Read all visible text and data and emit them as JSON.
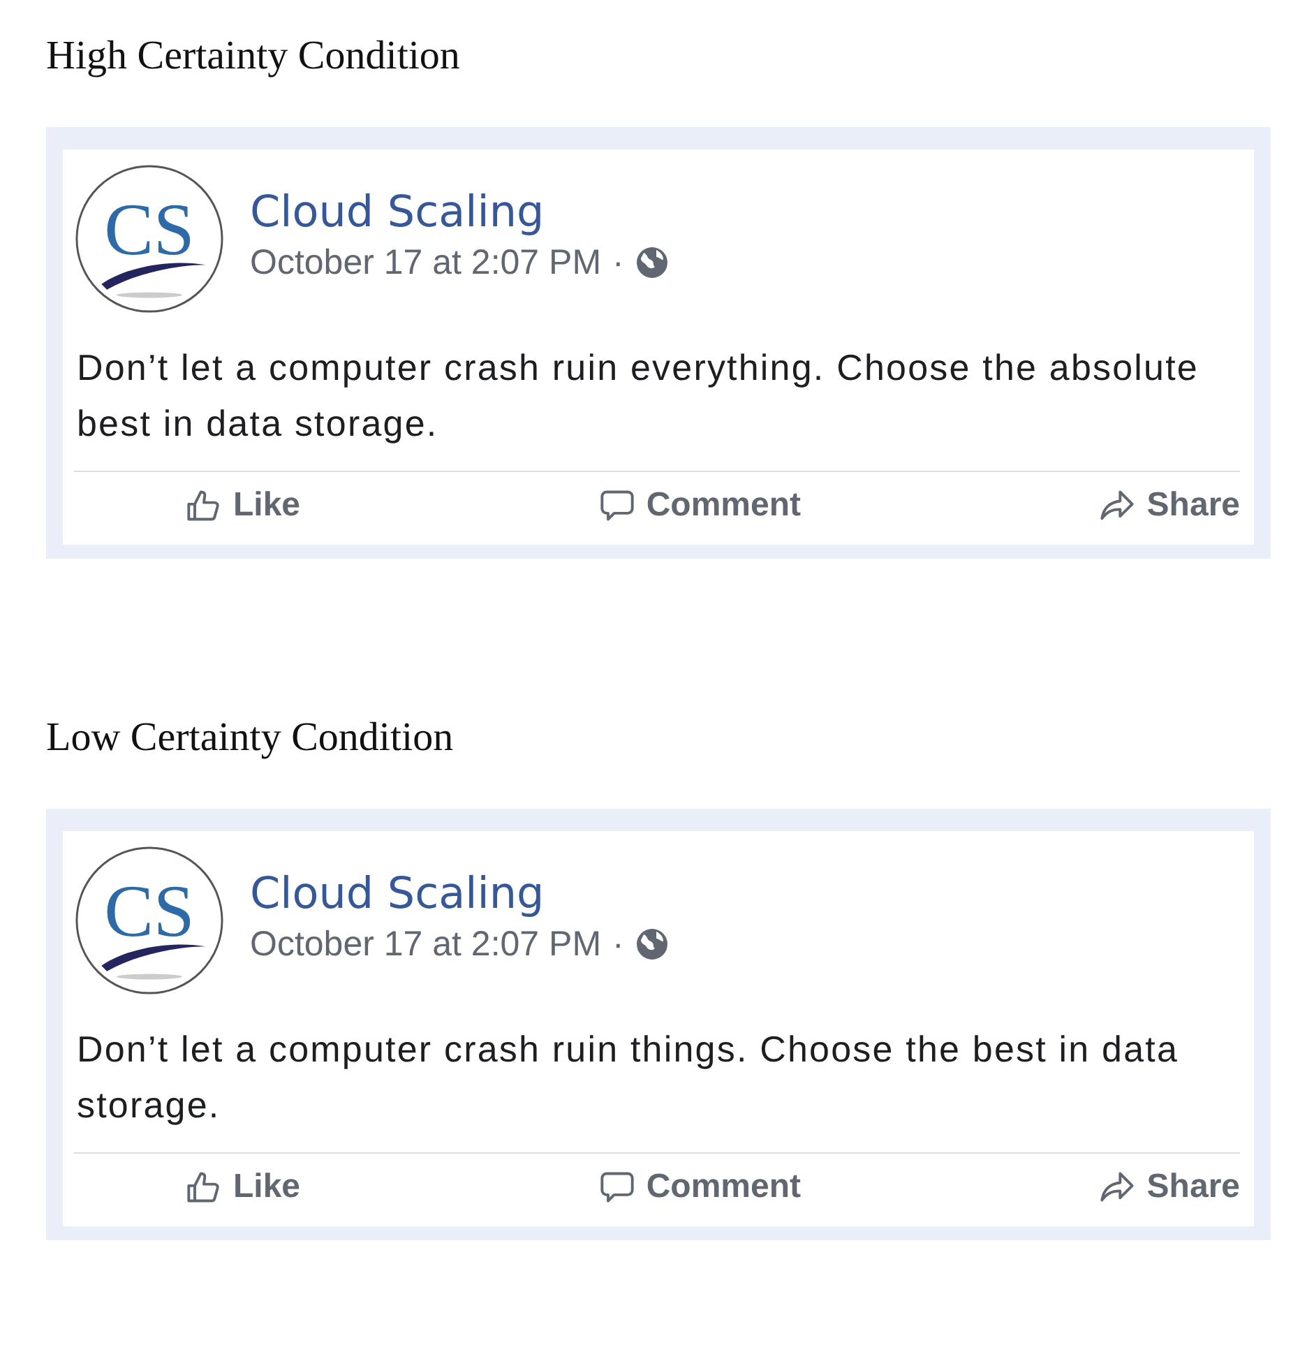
{
  "conditions": [
    {
      "heading": "High Certainty Condition",
      "post": {
        "logo_text": "CS",
        "page_name": "Cloud Scaling",
        "timestamp": "October 17 at 2:07 PM",
        "separator": "·",
        "body": "Don’t let a computer crash ruin everything. Choose the absolute best in data storage.",
        "actions": [
          {
            "kind": "like",
            "label": "Like"
          },
          {
            "kind": "comment",
            "label": "Comment"
          },
          {
            "kind": "share",
            "label": "Share"
          }
        ]
      }
    },
    {
      "heading": "Low Certainty Condition",
      "post": {
        "logo_text": "CS",
        "page_name": "Cloud Scaling",
        "timestamp": "October 17 at 2:07 PM",
        "separator": "·",
        "body": "Don’t let a computer crash ruin things. Choose the best in data storage.",
        "actions": [
          {
            "kind": "like",
            "label": "Like"
          },
          {
            "kind": "comment",
            "label": "Comment"
          },
          {
            "kind": "share",
            "label": "Share"
          }
        ]
      }
    }
  ]
}
